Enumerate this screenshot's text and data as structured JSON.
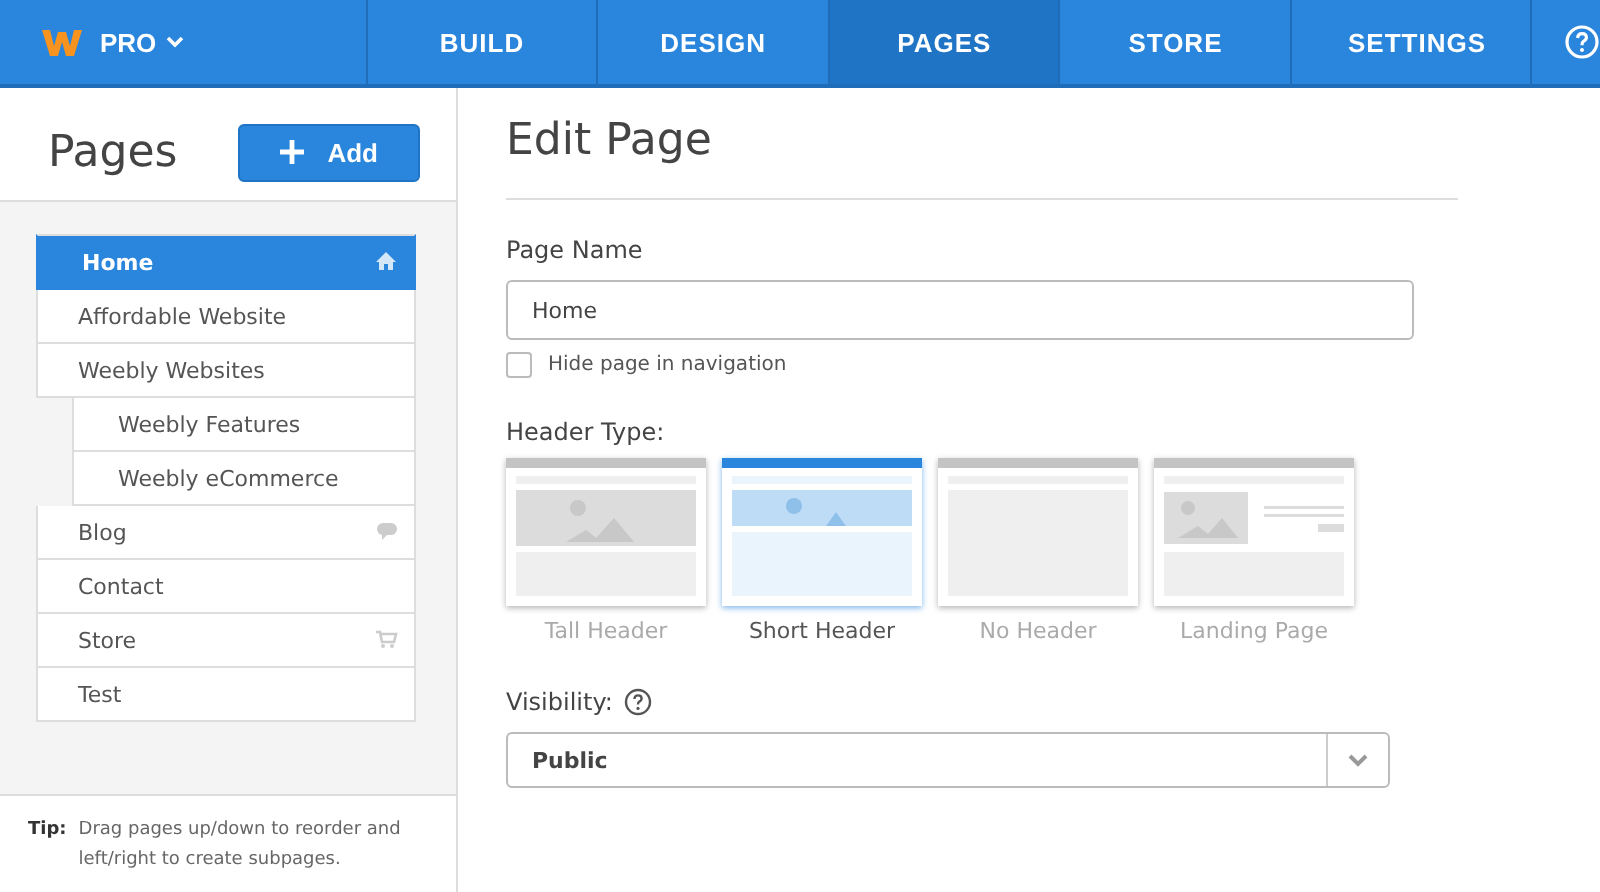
{
  "topbar": {
    "plan": "PRO",
    "tabs": [
      {
        "label": "BUILD",
        "selected": false
      },
      {
        "label": "DESIGN",
        "selected": false
      },
      {
        "label": "PAGES",
        "selected": true
      },
      {
        "label": "STORE",
        "selected": false
      },
      {
        "label": "SETTINGS",
        "selected": false
      }
    ]
  },
  "sidebar": {
    "title": "Pages",
    "add_button": "Add",
    "pages": [
      {
        "label": "Home",
        "kind": "home",
        "selected": true
      },
      {
        "label": "Affordable Website",
        "selected": false
      },
      {
        "label": "Weebly Websites",
        "selected": false,
        "children": [
          {
            "label": "Weebly Features",
            "selected": false
          },
          {
            "label": "Weebly eCommerce",
            "selected": false
          }
        ]
      },
      {
        "label": "Blog",
        "kind": "blog",
        "selected": false
      },
      {
        "label": "Contact",
        "selected": false
      },
      {
        "label": "Store",
        "kind": "store",
        "selected": false
      },
      {
        "label": "Test",
        "selected": false
      }
    ],
    "tip_label": "Tip:",
    "tip": "Drag pages up/down to reorder and left/right to create subpages."
  },
  "main": {
    "title": "Edit Page",
    "page_name_label": "Page Name",
    "page_name": "Home",
    "hide_label": "Hide page in navigation",
    "hide_checked": false,
    "header_type_label": "Header Type:",
    "header_types": [
      {
        "label": "Tall Header",
        "kind": "tall",
        "selected": false
      },
      {
        "label": "Short Header",
        "kind": "short",
        "selected": true
      },
      {
        "label": "No Header",
        "kind": "none",
        "selected": false
      },
      {
        "label": "Landing Page",
        "kind": "landing",
        "selected": false
      }
    ],
    "visibility_label": "Visibility:",
    "visibility": "Public"
  }
}
